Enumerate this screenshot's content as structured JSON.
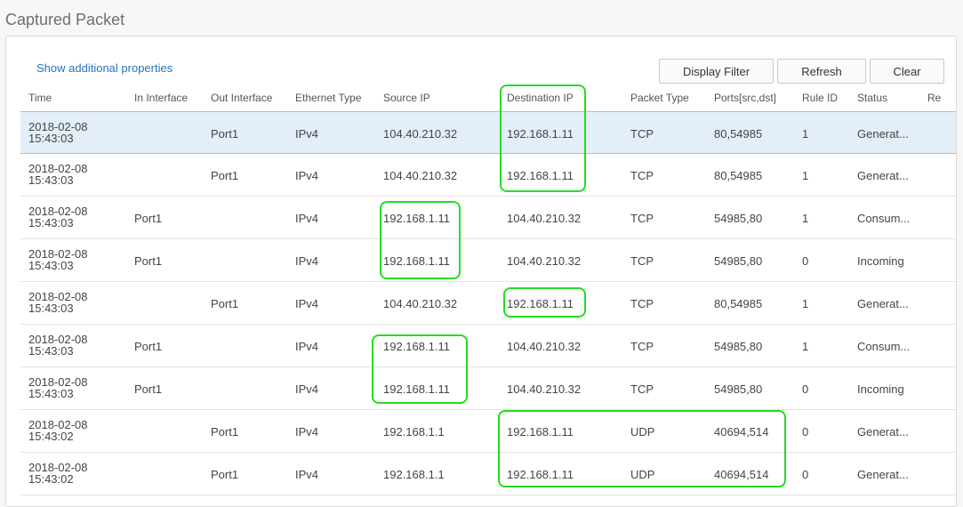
{
  "page": {
    "title": "Captured Packet"
  },
  "toolbar": {
    "show_additional": "Show additional properties",
    "display_filter": "Display Filter",
    "refresh": "Refresh",
    "clear": "Clear"
  },
  "table": {
    "headers": {
      "time": "Time",
      "in_interface": "In Interface",
      "out_interface": "Out Interface",
      "ethernet_type": "Ethernet Type",
      "source_ip": "Source IP",
      "destination_ip": "Destination IP",
      "packet_type": "Packet Type",
      "ports": "Ports[src,dst]",
      "rule_id": "Rule ID",
      "status": "Status",
      "reason": "Re"
    },
    "rows": [
      {
        "date": "2018-02-08",
        "clock": "15:43:03",
        "in": "",
        "out": "Port1",
        "eth": "IPv4",
        "src": "104.40.210.32",
        "dst": "192.168.1.11",
        "ptype": "TCP",
        "ports": "80,54985",
        "rule": "1",
        "status": "Generat..."
      },
      {
        "date": "2018-02-08",
        "clock": "15:43:03",
        "in": "",
        "out": "Port1",
        "eth": "IPv4",
        "src": "104.40.210.32",
        "dst": "192.168.1.11",
        "ptype": "TCP",
        "ports": "80,54985",
        "rule": "1",
        "status": "Generat..."
      },
      {
        "date": "2018-02-08",
        "clock": "15:43:03",
        "in": "Port1",
        "out": "",
        "eth": "IPv4",
        "src": "192.168.1.11",
        "dst": "104.40.210.32",
        "ptype": "TCP",
        "ports": "54985,80",
        "rule": "1",
        "status": "Consum..."
      },
      {
        "date": "2018-02-08",
        "clock": "15:43:03",
        "in": "Port1",
        "out": "",
        "eth": "IPv4",
        "src": "192.168.1.11",
        "dst": "104.40.210.32",
        "ptype": "TCP",
        "ports": "54985,80",
        "rule": "0",
        "status": "Incoming"
      },
      {
        "date": "2018-02-08",
        "clock": "15:43:03",
        "in": "",
        "out": "Port1",
        "eth": "IPv4",
        "src": "104.40.210.32",
        "dst": "192.168.1.11",
        "ptype": "TCP",
        "ports": "80,54985",
        "rule": "1",
        "status": "Generat..."
      },
      {
        "date": "2018-02-08",
        "clock": "15:43:03",
        "in": "Port1",
        "out": "",
        "eth": "IPv4",
        "src": "192.168.1.11",
        "dst": "104.40.210.32",
        "ptype": "TCP",
        "ports": "54985,80",
        "rule": "1",
        "status": "Consum..."
      },
      {
        "date": "2018-02-08",
        "clock": "15:43:03",
        "in": "Port1",
        "out": "",
        "eth": "IPv4",
        "src": "192.168.1.11",
        "dst": "104.40.210.32",
        "ptype": "TCP",
        "ports": "54985,80",
        "rule": "0",
        "status": "Incoming"
      },
      {
        "date": "2018-02-08",
        "clock": "15:43:02",
        "in": "",
        "out": "Port1",
        "eth": "IPv4",
        "src": "192.168.1.1",
        "dst": "192.168.1.11",
        "ptype": "UDP",
        "ports": "40694,514",
        "rule": "0",
        "status": "Generat..."
      },
      {
        "date": "2018-02-08",
        "clock": "15:43:02",
        "in": "",
        "out": "Port1",
        "eth": "IPv4",
        "src": "192.168.1.1",
        "dst": "192.168.1.11",
        "ptype": "UDP",
        "ports": "40694,514",
        "rule": "0",
        "status": "Generat..."
      }
    ]
  },
  "colors": {
    "highlight": "#22dd22",
    "link": "#2a72b8",
    "selected_row": "#e3eef8"
  }
}
